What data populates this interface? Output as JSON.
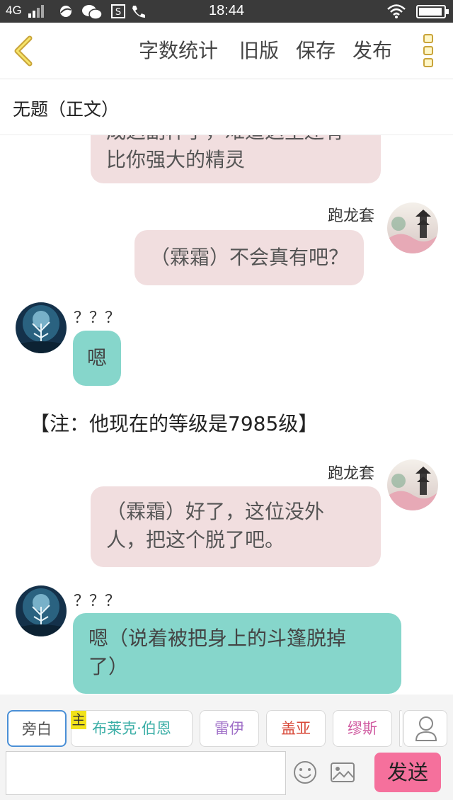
{
  "status_bar": {
    "network": "4G",
    "time": "18:44",
    "battery_level": 0.95,
    "icons": [
      "signal-icon",
      "browser-icon",
      "wechat-icon",
      "s-app-icon",
      "phone-icon",
      "wifi-icon",
      "battery-icon"
    ]
  },
  "header": {
    "back_icon": "chevron-left-icon",
    "buttons": [
      "字数统计",
      "旧版",
      "保存",
      "发布"
    ],
    "menu_icon": "more-vertical-icon"
  },
  "subtitle": "无题（正文）",
  "messages": [
    {
      "type": "right",
      "name": "",
      "lines": [
        "成这副样子，难道这里还有",
        "比你强大的精灵"
      ],
      "color": "pink"
    },
    {
      "type": "right",
      "name": "跑龙套",
      "lines": [
        "（霖霜）不会真有吧？"
      ],
      "color": "pink"
    },
    {
      "type": "left",
      "name": "？？？",
      "lines": [
        "嗯"
      ],
      "color": "teal"
    },
    {
      "type": "note",
      "text": "【注：他现在的等级是7985级】"
    },
    {
      "type": "right",
      "name": "跑龙套",
      "lines": [
        "（霖霜）好了，这位没外",
        "人，把这个脱了吧。"
      ],
      "color": "pink"
    },
    {
      "type": "left",
      "name": "？？？",
      "lines": [
        "嗯（说着被把身上的斗篷脱掉",
        "了）"
      ],
      "color": "teal"
    }
  ],
  "roles": [
    {
      "label": "旁白",
      "color": "#555555",
      "selected": true
    },
    {
      "label": "布莱克·伯恩",
      "color": "#3aaea6",
      "selected": false,
      "tag": "主"
    },
    {
      "label": "雷伊",
      "color": "#a070c8",
      "selected": false
    },
    {
      "label": "盖亚",
      "color": "#d84a3a",
      "selected": false
    },
    {
      "label": "缪斯",
      "color": "#d05aa0",
      "selected": false
    }
  ],
  "input": {
    "value": "",
    "placeholder": ""
  },
  "send_label": "发送",
  "colors": {
    "pink_bubble": "#f1dedf",
    "teal_bubble": "#86d6cb",
    "send_button": "#f5709c",
    "accent_gold": "#c9a43a"
  }
}
